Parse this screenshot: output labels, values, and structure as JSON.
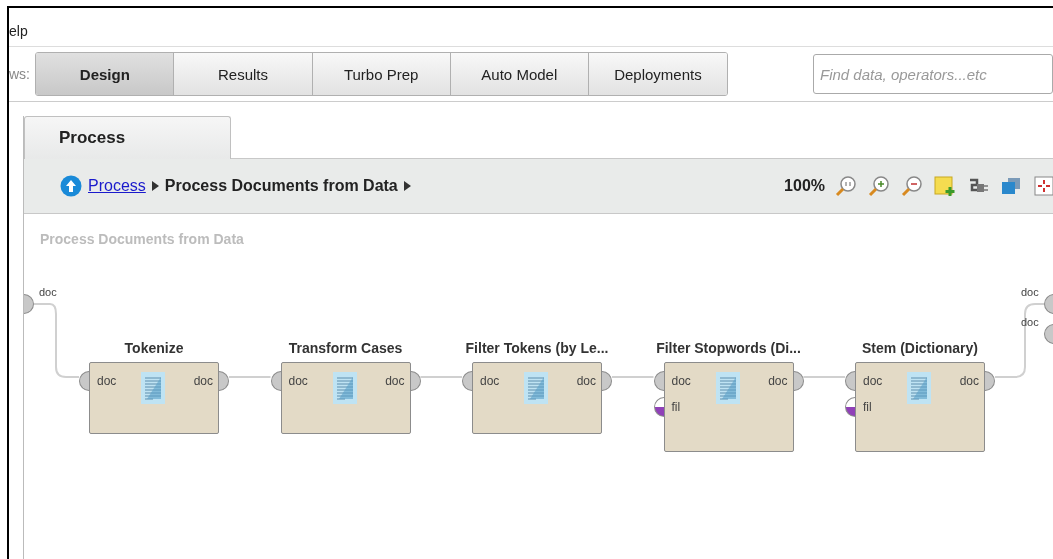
{
  "menu": {
    "title": "elp"
  },
  "views": {
    "label": "ws:",
    "tabs": [
      {
        "label": "Design",
        "selected": true
      },
      {
        "label": "Results",
        "selected": false
      },
      {
        "label": "Turbo Prep",
        "selected": false
      },
      {
        "label": "Auto Model",
        "selected": false
      },
      {
        "label": "Deployments",
        "selected": false
      }
    ]
  },
  "search": {
    "placeholder": "Find data, operators...etc"
  },
  "panel_tab": {
    "label": "Process"
  },
  "breadcrumb": {
    "link": "Process",
    "current": "Process Documents from Data",
    "zoom": "100%"
  },
  "canvas": {
    "title": "Process Documents from Data",
    "left_ports": [
      {
        "label": "doc",
        "kind": "doc"
      }
    ],
    "right_ports": [
      {
        "label": "doc",
        "kind": "doc"
      },
      {
        "label": "doc",
        "kind": "doc"
      }
    ],
    "operators": [
      {
        "name": "Tokenize",
        "inputs": [
          {
            "label": "doc",
            "kind": "doc"
          }
        ],
        "outputs": [
          {
            "label": "doc",
            "kind": "doc"
          }
        ]
      },
      {
        "name": "Transform Cases",
        "inputs": [
          {
            "label": "doc",
            "kind": "doc"
          }
        ],
        "outputs": [
          {
            "label": "doc",
            "kind": "doc"
          }
        ]
      },
      {
        "name": "Filter Tokens (by Le...",
        "inputs": [
          {
            "label": "doc",
            "kind": "doc"
          }
        ],
        "outputs": [
          {
            "label": "doc",
            "kind": "doc"
          }
        ]
      },
      {
        "name": "Filter Stopwords (Di...",
        "inputs": [
          {
            "label": "doc",
            "kind": "doc"
          },
          {
            "label": "fil",
            "kind": "fil"
          }
        ],
        "outputs": [
          {
            "label": "doc",
            "kind": "doc"
          }
        ]
      },
      {
        "name": "Stem (Dictionary)",
        "inputs": [
          {
            "label": "doc",
            "kind": "doc"
          },
          {
            "label": "fil",
            "kind": "fil"
          }
        ],
        "outputs": [
          {
            "label": "doc",
            "kind": "doc"
          }
        ]
      }
    ]
  }
}
